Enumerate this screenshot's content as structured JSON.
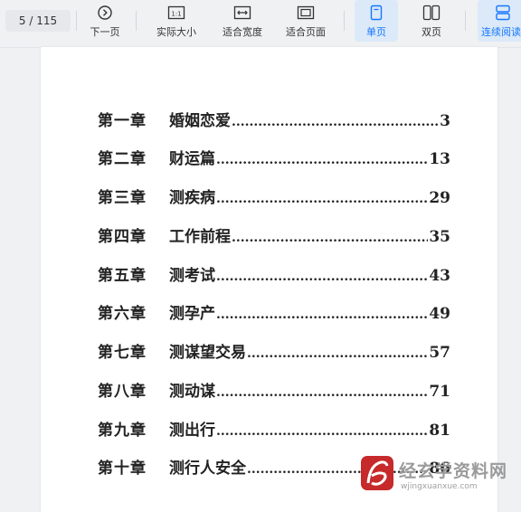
{
  "toolbar": {
    "page_indicator": "5 / 115",
    "buttons": {
      "next_page": "下一页",
      "actual_size": "实际大小",
      "fit_width": "适合宽度",
      "fit_page": "适合页面",
      "single_page": "单页",
      "double_page": "双页",
      "continuous": "连续阅读"
    },
    "actual_size_icon_text": "1:1",
    "active_color": "#1677ff"
  },
  "toc": [
    {
      "chapter": "第一章",
      "title": "婚姻恋爱",
      "page": "3"
    },
    {
      "chapter": "第二章",
      "title": "财运篇",
      "page": "13"
    },
    {
      "chapter": "第三章",
      "title": "测疾病",
      "page": "29"
    },
    {
      "chapter": "第四章",
      "title": "工作前程",
      "page": "35"
    },
    {
      "chapter": "第五章",
      "title": "测考试",
      "page": "43"
    },
    {
      "chapter": "第六章",
      "title": "测孕产",
      "page": "49"
    },
    {
      "chapter": "第七章",
      "title": "测谋望交易",
      "page": "57"
    },
    {
      "chapter": "第八章",
      "title": "测动谋",
      "page": "71"
    },
    {
      "chapter": "第九章",
      "title": "测出行",
      "page": "81"
    },
    {
      "chapter": "第十章",
      "title": "测行人安全",
      "page": "86"
    }
  ],
  "watermark": {
    "text": "经玄学资料网",
    "url": "wjingxuanxue.com"
  }
}
